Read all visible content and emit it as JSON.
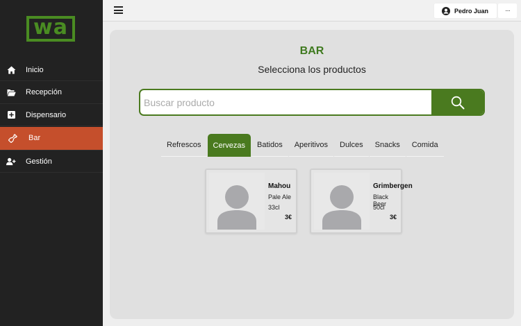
{
  "logo": {
    "text": "wa"
  },
  "sidebar": {
    "items": [
      {
        "label": "Inicio",
        "icon": "home-icon"
      },
      {
        "label": "Recepción",
        "icon": "folder-open-icon"
      },
      {
        "label": "Dispensario",
        "icon": "plus-square-icon"
      },
      {
        "label": "Bar",
        "icon": "bottle-icon",
        "active": true
      },
      {
        "label": "Gestión",
        "icon": "user-plus-icon"
      }
    ]
  },
  "topbar": {
    "user_name": "Pedro Juan",
    "more_label": "···"
  },
  "main": {
    "title": "BAR",
    "subtitle": "Selecciona los productos",
    "search": {
      "placeholder": "Buscar producto",
      "value": ""
    },
    "tabs": [
      "Refrescos",
      "Cervezas",
      "Batidos",
      "Aperitivos",
      "Dulces",
      "Snacks",
      "Comida"
    ],
    "active_tab": "Cervezas",
    "products": [
      {
        "name": "Mahou",
        "description": "Pale Ale",
        "size": "33cl",
        "price": "3€"
      },
      {
        "name": "Grimbergen",
        "description": "Black Beer",
        "size": "50cl",
        "price": "3€"
      }
    ]
  },
  "colors": {
    "brand_green": "#4a7a1f",
    "active_nav": "#c54f2c",
    "sidebar_bg": "#222222"
  }
}
